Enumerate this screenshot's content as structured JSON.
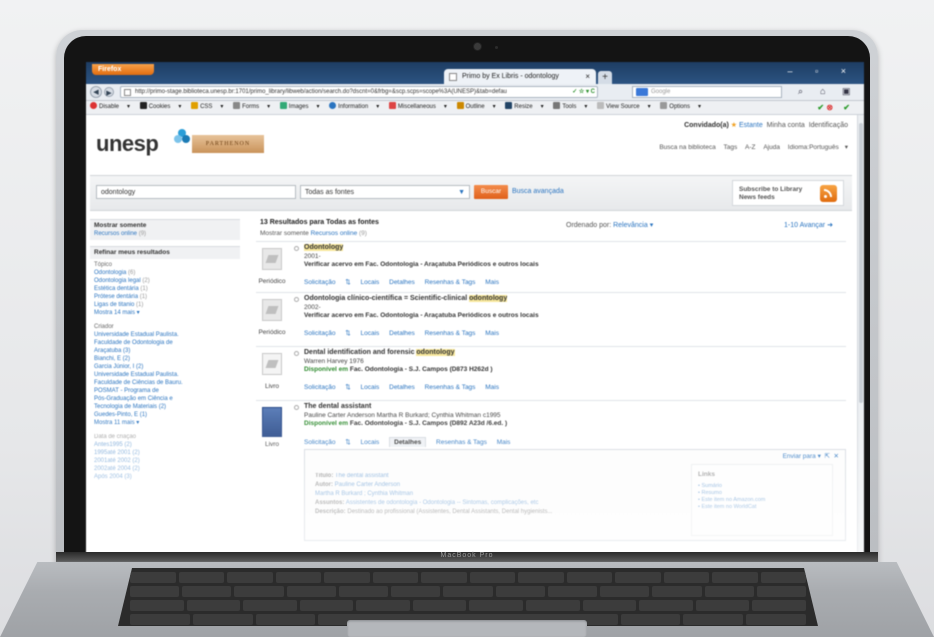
{
  "browser": {
    "app_button": "Firefox",
    "tab_title": "Primo by Ex Libris - odontology",
    "url": "http://primo-stage.biblioteca.unesp.br:1701/primo_library/libweb/action/search.do?dscnt=0&frbg=&scp.scps=scope%3A(UNESP)&tab=defau",
    "search_placeholder": "Google"
  },
  "devbar": {
    "items": [
      "Disable",
      "Cookies",
      "CSS",
      "Forms",
      "Images",
      "Information",
      "Miscellaneous",
      "Outline",
      "Resize",
      "Tools",
      "View Source",
      "Options"
    ]
  },
  "header": {
    "logo": "unesp",
    "sublogo": "PARTHENON",
    "user": "Convidado(a)",
    "user_links": [
      "Estante",
      "Minha conta",
      "Identificação"
    ],
    "site_links": [
      "Busca na biblioteca",
      "Tags",
      "A-Z",
      "Ajuda",
      "Idioma:Português"
    ]
  },
  "search": {
    "query": "odontology",
    "scope": "Todas as fontes",
    "button": "Buscar",
    "advanced": "Busca avançada",
    "subscribe": "Subscribe to Library News feeds"
  },
  "sidebar": {
    "show_only_head": "Mostrar somente",
    "online_label": "Recursos online",
    "online_count": "(9)",
    "refine_head": "Refinar meus resultados",
    "topic_label": "Tópico",
    "topics": [
      {
        "label": "Odontologia",
        "count": "(6)"
      },
      {
        "label": "Odontologia legal",
        "count": "(2)"
      },
      {
        "label": "Estética dentária",
        "count": "(1)"
      },
      {
        "label": "Prótese dentária",
        "count": "(1)"
      },
      {
        "label": "Ligas de titanio",
        "count": "(1)"
      }
    ],
    "topic_more": "Mostra 14 mais",
    "creator_label": "Criador",
    "creators": [
      "Universidade Estadual Paulista.",
      "Faculdade de Odontologia de",
      "Araçatuba (3)",
      "Bianchi, E (2)",
      "Garcia Júnior, I (2)",
      "Universidade Estadual Paulista.",
      "Faculdade de Ciências de Bauru.",
      "POSMAT - Programa de",
      "Pós-Graduação em Ciência e",
      "Tecnologia de Materiais (2)",
      "Guedes-Pinto, E (1)"
    ],
    "creator_more": "Mostra 11 mais",
    "date_label": "Data de criação",
    "dates": [
      "Antes1995 (2)",
      "1995até 2001 (2)",
      "2001até 2002 (2)",
      "2002até 2004 (2)",
      "Após 2004 (3)"
    ]
  },
  "results": {
    "count_text": "13 Resultados para",
    "count_scope": "Todas as fontes",
    "show_only": "Mostrar somente",
    "show_only_link": "Recursos online",
    "show_only_count": "(9)",
    "sort_label": "Ordenado por:",
    "sort_value": "Relevância",
    "pager": "1-10 Avançar"
  },
  "records": [
    {
      "type": "Periódico",
      "title_pre": "",
      "title_hl": "Odontology",
      "title_post": "",
      "line1": "2001-",
      "line2_b": "Verificar acervo em Fac. Odontologia - Araçatuba Periódicos",
      "line2_rest": "e outros locais",
      "tabs": [
        "Solicitação",
        "Locais",
        "Detalhes",
        "Resenhas & Tags",
        "Mais"
      ]
    },
    {
      "type": "Periódico",
      "title_pre": "Odontologia clínico-científica = Scientific-clinical ",
      "title_hl": "odontology",
      "title_post": "",
      "line1": "2002-",
      "line2_b": "Verificar acervo em Fac. Odontologia - Araçatuba Periódicos",
      "line2_rest": "e outros locais",
      "tabs": [
        "Solicitação",
        "Locais",
        "Detalhes",
        "Resenhas & Tags",
        "Mais"
      ]
    },
    {
      "type": "Livro",
      "title_pre": "Dental identification and forensic ",
      "title_hl": "odontology",
      "title_post": "",
      "line1": "Warren Harvey 1976",
      "avail": "Disponível em",
      "line2_rest": "Fac. Odontologia - S.J. Campos   (D873 H262d )",
      "tabs": [
        "Solicitação",
        "Locais",
        "Detalhes",
        "Resenhas & Tags",
        "Mais"
      ]
    },
    {
      "type": "Livro",
      "title_pre": "The dental assistant",
      "title_hl": "",
      "title_post": "",
      "line1": "Pauline Carter Anderson Martha R Burkard; Cynthia Whitman c1995",
      "avail": "Disponível em",
      "line2_rest": "Fac. Odontologia - S.J. Campos   (D892 A23d /6.ed. )",
      "tabs": [
        "Solicitação",
        "Locais",
        "Detalhes",
        "Resenhas & Tags",
        "Mais"
      ]
    }
  ],
  "details": {
    "send_to": "Enviar para",
    "title_k": "Título:",
    "title_v": "The dental assistant",
    "author_k": "Autor:",
    "author_v": "Pauline Carter Anderson",
    "author2": "Martha R Burkard ; Cynthia Whitman",
    "subject_k": "Assuntos:",
    "subject_v": "Assistentes de odontologia - Odontologia -- Sintomas, complicações, etc",
    "desc_k": "Descrição:",
    "desc_v": "Destinado ao profissional (Assistentes, Dental Assistants, Dental hygienists...",
    "links_head": "Links",
    "links": [
      "Sumário",
      "Resumo",
      "Este item no Amazon.com",
      "Este item no WorldCat"
    ]
  },
  "laptop": {
    "model": "MacBook Pro"
  }
}
